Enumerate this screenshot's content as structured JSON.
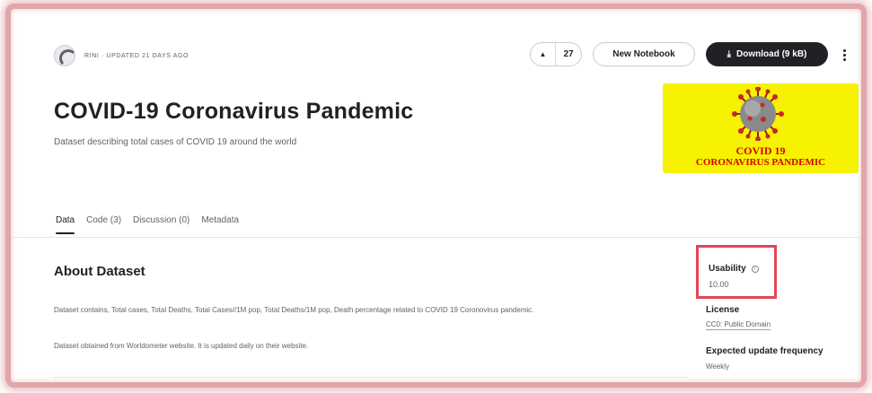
{
  "header": {
    "owner_text": "RINI · UPDATED 21 DAYS AGO",
    "vote_count": "27",
    "new_notebook_label": "New Notebook",
    "download_label": "Download (9 kB)"
  },
  "dataset": {
    "title": "COVID-19 Coronavirus Pandemic",
    "subtitle": "Dataset describing total cases of COVID 19 around the world",
    "banner_line1": "COVID 19",
    "banner_line2": "CORONAVIRUS PANDEMIC"
  },
  "tabs": [
    {
      "label": "Data",
      "active": true
    },
    {
      "label": "Code (3)",
      "active": false
    },
    {
      "label": "Discussion (0)",
      "active": false
    },
    {
      "label": "Metadata",
      "active": false
    }
  ],
  "about": {
    "title": "About Dataset",
    "paragraph1": "Dataset contains, Total cases, Total Deaths, Total Cases//1M pop, Total Deaths/1M pop, Death percentage related to COVID 19 Coronovirus pandemic.",
    "paragraph2": "Dataset obtained from Worldometer website. It is updated daily on their website."
  },
  "meta": {
    "usability_label": "Usability",
    "usability_value": "10.00",
    "license_label": "License",
    "license_value": "CC0: Public Domain",
    "frequency_label": "Expected update frequency",
    "frequency_value": "Weekly"
  },
  "colors": {
    "highlight_border": "#e5435a",
    "frame_glow": "#e2a5a8",
    "banner_bg": "#f6f200",
    "banner_text": "#d50000",
    "primary_button": "#202124"
  },
  "icons": {
    "vote": "caret-up-icon",
    "download": "download-icon",
    "more": "more-vertical-icon",
    "info": "info-icon"
  }
}
